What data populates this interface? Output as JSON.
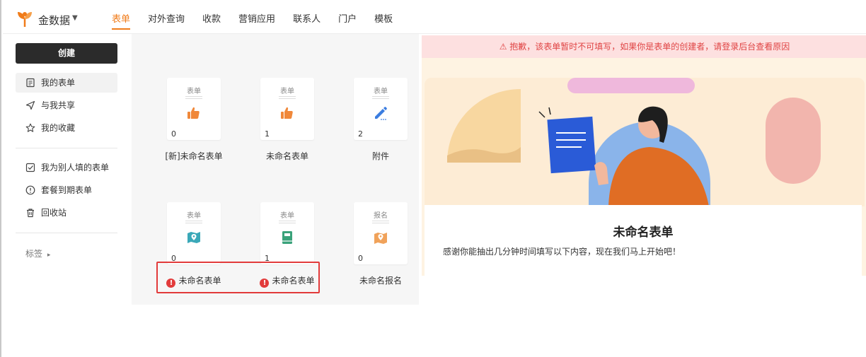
{
  "app": {
    "brand": "金数据"
  },
  "nav": {
    "items": [
      "表单",
      "对外查询",
      "收款",
      "营销应用",
      "联系人",
      "门户",
      "模板"
    ],
    "active": 0
  },
  "sidebar": {
    "create_label": "创建",
    "group1": [
      "我的表单",
      "与我共享",
      "我的收藏"
    ],
    "group2": [
      "我为别人填的表单",
      "套餐到期表单",
      "回收站"
    ],
    "tags_label": "标签",
    "tags_caret": "▸"
  },
  "forms": [
    {
      "type": "表单",
      "icon": "thumbs-up-icon",
      "count": "0",
      "name": "[新]未命名表单",
      "warning": false
    },
    {
      "type": "表单",
      "icon": "thumbs-up-icon",
      "count": "1",
      "name": "未命名表单",
      "warning": false
    },
    {
      "type": "表单",
      "icon": "pen-icon",
      "count": "2",
      "name": "附件",
      "warning": false
    },
    {
      "type": "表单",
      "icon": "map-pin-icon",
      "count": "0",
      "name": "未命名表单",
      "warning": true
    },
    {
      "type": "表单",
      "icon": "book-icon",
      "count": "1",
      "name": "未命名表单",
      "warning": true
    },
    {
      "type": "报名",
      "icon": "location-icon",
      "count": "0",
      "name": "未命名报名",
      "warning": false
    }
  ],
  "preview": {
    "alert": "⚠ 抱歉，该表单暂时不可填写，如果你是表单的创建者，请登录后台查看原因",
    "title": "未命名表单",
    "description": "感谢你能抽出几分钟时间填写以下内容，现在我们马上开始吧！"
  },
  "colors": {
    "accent": "#f07c1a",
    "warning": "#e23b3b",
    "alert_bg": "#fde0e0",
    "dark_button": "#2b2b2b"
  }
}
